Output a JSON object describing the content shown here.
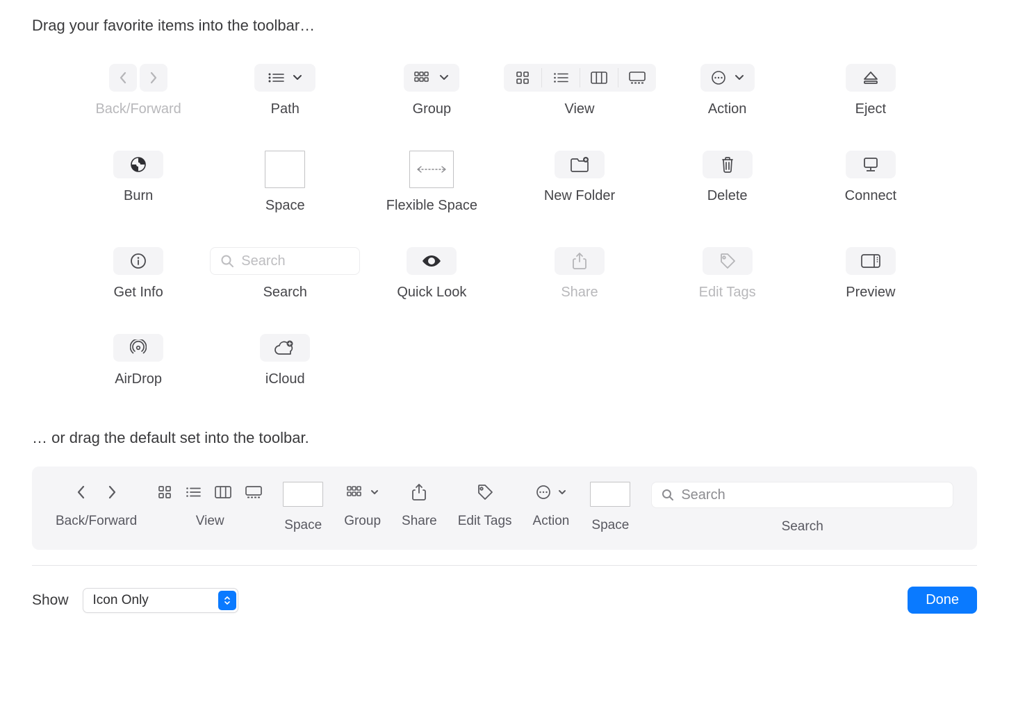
{
  "heading_top": "Drag your favorite items into the toolbar…",
  "heading_default": "… or drag the default set into the toolbar.",
  "items": {
    "back_forward": "Back/Forward",
    "path": "Path",
    "group": "Group",
    "view": "View",
    "action": "Action",
    "eject": "Eject",
    "burn": "Burn",
    "space": "Space",
    "flexible_space": "Flexible Space",
    "new_folder": "New Folder",
    "delete": "Delete",
    "connect": "Connect",
    "get_info": "Get Info",
    "search": "Search",
    "quick_look": "Quick Look",
    "share": "Share",
    "edit_tags": "Edit Tags",
    "preview": "Preview",
    "airdrop": "AirDrop",
    "icloud": "iCloud"
  },
  "search_placeholder": "Search",
  "default_set": {
    "back_forward": "Back/Forward",
    "view": "View",
    "space1": "Space",
    "group": "Group",
    "share": "Share",
    "edit_tags": "Edit Tags",
    "action": "Action",
    "space2": "Space",
    "search": "Search"
  },
  "bottom": {
    "show_label": "Show",
    "select_value": "Icon Only",
    "done": "Done"
  }
}
